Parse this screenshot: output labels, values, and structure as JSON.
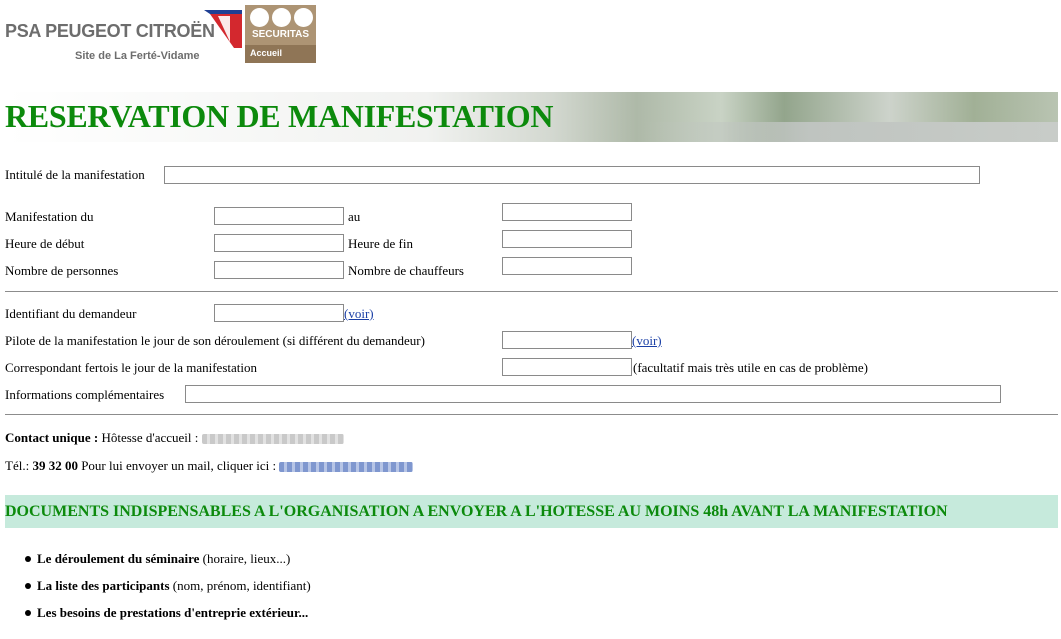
{
  "logo": {
    "company": "PSA PEUGEOT CITROËN",
    "site": "Site de La Ferté-Vidame",
    "partner": "SECURITAS",
    "partner_sub": "Accueil"
  },
  "banner": {
    "title": "RESERVATION DE MANIFESTATION"
  },
  "form": {
    "intitule_label": "Intitulé de la manifestation",
    "manifestation_du_label": "Manifestation du",
    "au_label": "au",
    "heure_debut_label": "Heure de début",
    "heure_fin_label": "Heure de fin",
    "nombre_personnes_label": "Nombre de personnes",
    "nombre_chauffeurs_label": "Nombre de chauffeurs",
    "identifiant_label": "Identifiant du demandeur",
    "voir_link": "(voir)",
    "pilote_label": "Pilote de la manifestation le jour de son déroulement (si différent du demandeur)",
    "correspondant_label": "Correspondant fertois le jour de la manifestation",
    "correspondant_note": "(facultatif mais très utile en cas de problème)",
    "infos_label": "Informations complémentaires"
  },
  "contact": {
    "title": "Contact unique :",
    "hotesse_label": "Hôtesse d'accueil :",
    "tel_label": "Tél.:",
    "tel_number": "39 32 00",
    "mail_text": "Pour lui envoyer un mail, cliquer ici :"
  },
  "documents": {
    "heading": "DOCUMENTS INDISPENSABLES A L'ORGANISATION A ENVOYER A L'HOTESSE AU MOINS 48h AVANT LA MANIFESTATION",
    "items": [
      {
        "bold": "Le déroulement du séminaire",
        "rest": " (horaire, lieux...)"
      },
      {
        "bold": "La liste des participants",
        "rest": " (nom, prénom, identifiant)"
      },
      {
        "bold": "Les besoins de prestations d'entreprie extérieur...",
        "rest": ""
      }
    ]
  },
  "colors": {
    "title_green": "#0c8a0c",
    "section_bg": "#c6eadc",
    "link_blue": "#1a3fa6",
    "securitas_brown": "#ad9474"
  }
}
